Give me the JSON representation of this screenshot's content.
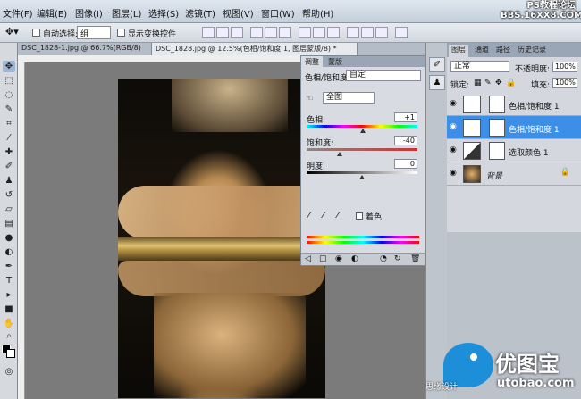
{
  "menu": {
    "items": [
      "文件(F)",
      "编辑(E)",
      "图像(I)",
      "图层(L)",
      "选择(S)",
      "滤镜(T)",
      "视图(V)",
      "窗口(W)",
      "帮助(H)"
    ],
    "watermark": "PS教程论坛\nBBS.16XX8.COM"
  },
  "options": {
    "auto_select_label": "自动选择:",
    "auto_select_value": "组",
    "show_transform_label": "显示变换控件"
  },
  "doc_tabs": [
    {
      "label": "DSC_1828-1.jpg @ 66.7%(RGB/8)",
      "active": false
    },
    {
      "label": "DSC_1828.jpg @ 12.5%(色相/饱和度 1, 图层蒙版/8) *",
      "active": true
    }
  ],
  "adjustments": {
    "tabs": [
      "调整",
      "蒙版"
    ],
    "title": "色相/饱和度",
    "preset": "自定",
    "channel": "全图",
    "hue_label": "色相:",
    "hue_value": "+1",
    "hue_position": 0.505,
    "saturation_label": "饱和度:",
    "saturation_value": "-40",
    "saturation_position": 0.3,
    "lightness_label": "明度:",
    "lightness_value": "0",
    "lightness_position": 0.5,
    "colorize_label": "着色"
  },
  "layers": {
    "tabs": [
      "图层",
      "通道",
      "路径",
      "历史记录"
    ],
    "blend_mode": "正常",
    "opacity_label": "不透明度:",
    "opacity_value": "100%",
    "lock_label": "锁定:",
    "fill_label": "填充:",
    "fill_value": "100%",
    "items": [
      {
        "name": "色相/饱和度 1",
        "selected": false
      },
      {
        "name": "色相/饱和度 1",
        "selected": true
      },
      {
        "name": "选取颜色 1",
        "selected": false
      },
      {
        "name": "背景",
        "selected": false
      }
    ]
  },
  "watermark": {
    "brand": "优图宝",
    "domain": "utobao.com",
    "small": "思缘设计"
  }
}
